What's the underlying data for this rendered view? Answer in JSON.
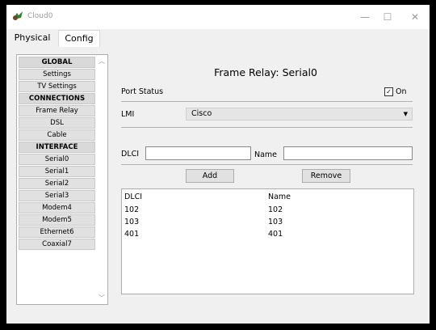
{
  "window": {
    "title": "Cloud0"
  },
  "tabs": [
    {
      "label": "Physical"
    },
    {
      "label": "Config"
    }
  ],
  "sidebar": {
    "items": [
      {
        "label": "GLOBAL",
        "header": true
      },
      {
        "label": "Settings"
      },
      {
        "label": "TV Settings"
      },
      {
        "label": "CONNECTIONS",
        "header": true
      },
      {
        "label": "Frame Relay"
      },
      {
        "label": "DSL"
      },
      {
        "label": "Cable"
      },
      {
        "label": "INTERFACE",
        "header": true
      },
      {
        "label": "Serial0"
      },
      {
        "label": "Serial1"
      },
      {
        "label": "Serial2"
      },
      {
        "label": "Serial3"
      },
      {
        "label": "Modem4"
      },
      {
        "label": "Modem5"
      },
      {
        "label": "Ethernet6"
      },
      {
        "label": "Coaxial7"
      }
    ]
  },
  "panel": {
    "title": "Frame Relay: Serial0",
    "port_status_label": "Port Status",
    "on_label": "On",
    "on_checked": true,
    "lmi_label": "LMI",
    "lmi_value": "Cisco",
    "dlci_label": "DLCI",
    "dlci_value": "",
    "name_label": "Name",
    "name_value": "",
    "add_label": "Add",
    "remove_label": "Remove",
    "table": {
      "headers": [
        "DLCI",
        "Name"
      ],
      "rows": [
        [
          "102",
          "102"
        ],
        [
          "103",
          "103"
        ],
        [
          "401",
          "401"
        ]
      ]
    }
  }
}
